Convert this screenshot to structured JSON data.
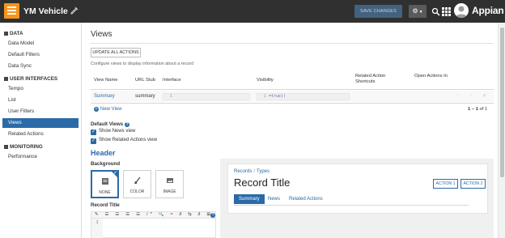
{
  "topbar": {
    "app_title": "YM Vehicle",
    "save_label": "SAVE CHANGES",
    "brand": "Appian"
  },
  "sidebar": {
    "sections": [
      {
        "title": "DATA",
        "items": [
          "Data Model",
          "Default Filters",
          "Data Sync"
        ]
      },
      {
        "title": "USER INTERFACES",
        "items": [
          "Tempo",
          "List",
          "User Filters",
          "Views",
          "Related Actions"
        ]
      },
      {
        "title": "MONITORING",
        "items": [
          "Performance"
        ]
      }
    ],
    "active_item": "Views"
  },
  "main": {
    "title": "Views",
    "update_button": "UPDATE ALL ACTIONS",
    "description": "Configure views to display information about a record",
    "table": {
      "headers": [
        "View Name",
        "URL Stub",
        "Interface",
        "Visibility",
        "Related Action Shortcuts",
        "Open Actions In"
      ],
      "rows": [
        {
          "name": "Summary",
          "stub": "summary",
          "interface_line": "1",
          "interface_code": "",
          "visibility_line": "1",
          "visibility_code": "=true()"
        }
      ],
      "new_view": "New View",
      "pager_range": "1 – 1",
      "pager_of": "of 1"
    },
    "default_views": {
      "label": "Default Views",
      "options": [
        "Show News view",
        "Show Related Actions view"
      ]
    },
    "header": {
      "title": "Header",
      "background_label": "Background",
      "options": [
        "NONE",
        "COLOR",
        "IMAGE"
      ],
      "selected": "NONE",
      "record_title_label": "Record Title",
      "toolbar_glyphs": "✎ ☰ ☰ ☰ ☰ /* 🔍 ≈ ∂ ⇆ ∂ ⊞",
      "editor_line": "1"
    },
    "preview": {
      "breadcrumb": [
        "Records",
        "Types"
      ],
      "record_title": "Record Title",
      "actions": [
        "ACTION 1",
        "ACTION 2"
      ],
      "tabs": [
        "Summary",
        "News",
        "Related Actions"
      ],
      "active_tab": "Summary"
    }
  },
  "colors": {
    "topbar": "#303030",
    "accent": "#2a6aa8",
    "logo": "#f7941d",
    "save_button": "#43627f"
  }
}
